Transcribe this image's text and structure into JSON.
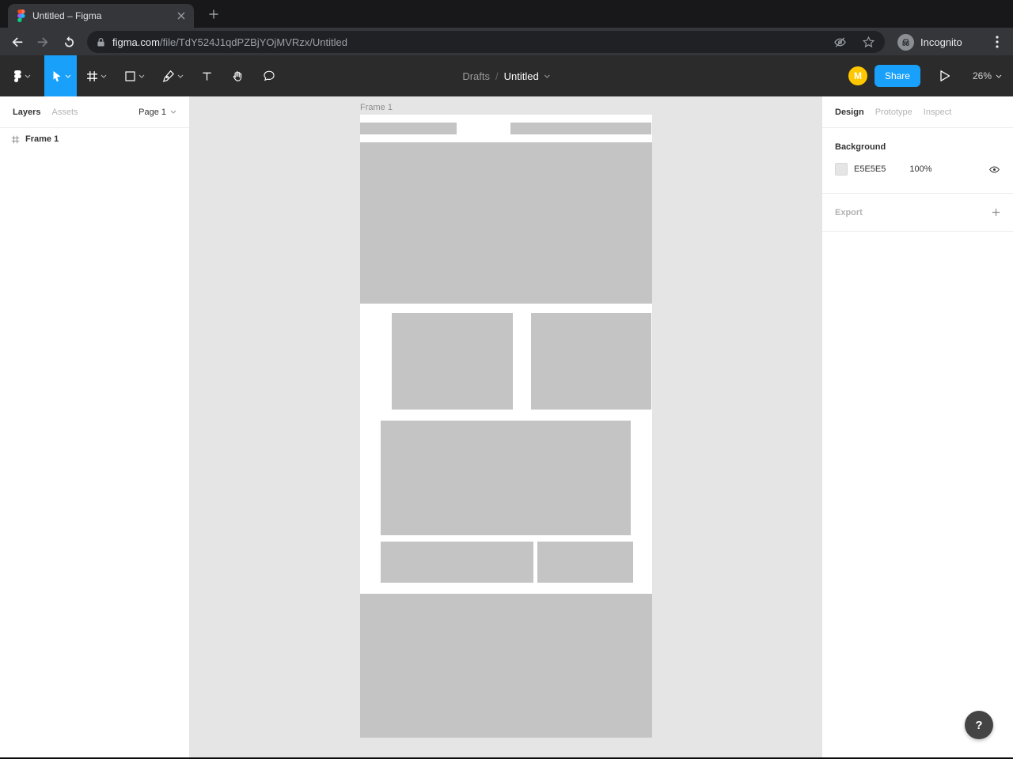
{
  "colors": {
    "accent_blue": "#18A0FB",
    "avatar_yellow": "#FFC700",
    "canvas_bg": "#E5E5E5",
    "placeholder_gray": "#C4C4C4"
  },
  "browser": {
    "tab_title": "Untitled – Figma",
    "url_host": "figma.com",
    "url_path": "/file/TdY524J1qdPZBjYOjMVRzx/Untitled",
    "incognito_label": "Incognito"
  },
  "figma_toolbar": {
    "breadcrumb": {
      "folder": "Drafts",
      "separator": "/",
      "file": "Untitled"
    },
    "avatar_initial": "M",
    "share_label": "Share",
    "zoom_level": "26%"
  },
  "left_panel": {
    "tab_layers": "Layers",
    "tab_assets": "Assets",
    "page_selector": "Page 1",
    "layers": [
      {
        "label": "Frame 1"
      }
    ]
  },
  "canvas": {
    "frame_label": "Frame 1"
  },
  "right_panel": {
    "tab_design": "Design",
    "tab_prototype": "Prototype",
    "tab_inspect": "Inspect",
    "background": {
      "title": "Background",
      "hex": "E5E5E5",
      "opacity": "100%"
    },
    "export": {
      "title": "Export"
    }
  },
  "help_button_label": "?"
}
